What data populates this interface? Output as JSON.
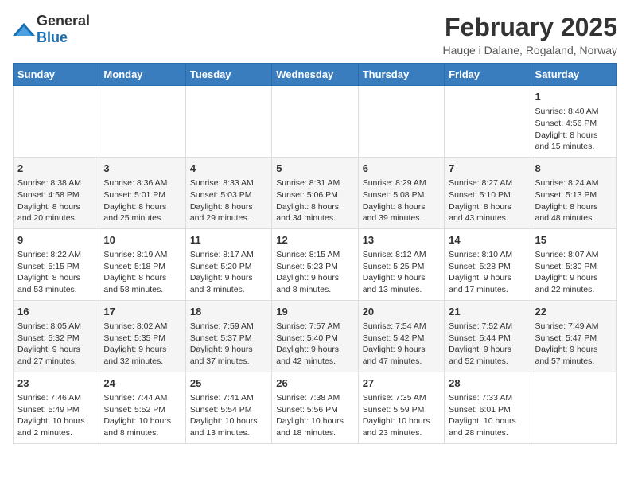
{
  "logo": {
    "general": "General",
    "blue": "Blue"
  },
  "title": "February 2025",
  "subtitle": "Hauge i Dalane, Rogaland, Norway",
  "days_of_week": [
    "Sunday",
    "Monday",
    "Tuesday",
    "Wednesday",
    "Thursday",
    "Friday",
    "Saturday"
  ],
  "weeks": [
    [
      {
        "day": "",
        "content": ""
      },
      {
        "day": "",
        "content": ""
      },
      {
        "day": "",
        "content": ""
      },
      {
        "day": "",
        "content": ""
      },
      {
        "day": "",
        "content": ""
      },
      {
        "day": "",
        "content": ""
      },
      {
        "day": "1",
        "content": "Sunrise: 8:40 AM\nSunset: 4:56 PM\nDaylight: 8 hours and 15 minutes."
      }
    ],
    [
      {
        "day": "2",
        "content": "Sunrise: 8:38 AM\nSunset: 4:58 PM\nDaylight: 8 hours and 20 minutes."
      },
      {
        "day": "3",
        "content": "Sunrise: 8:36 AM\nSunset: 5:01 PM\nDaylight: 8 hours and 25 minutes."
      },
      {
        "day": "4",
        "content": "Sunrise: 8:33 AM\nSunset: 5:03 PM\nDaylight: 8 hours and 29 minutes."
      },
      {
        "day": "5",
        "content": "Sunrise: 8:31 AM\nSunset: 5:06 PM\nDaylight: 8 hours and 34 minutes."
      },
      {
        "day": "6",
        "content": "Sunrise: 8:29 AM\nSunset: 5:08 PM\nDaylight: 8 hours and 39 minutes."
      },
      {
        "day": "7",
        "content": "Sunrise: 8:27 AM\nSunset: 5:10 PM\nDaylight: 8 hours and 43 minutes."
      },
      {
        "day": "8",
        "content": "Sunrise: 8:24 AM\nSunset: 5:13 PM\nDaylight: 8 hours and 48 minutes."
      }
    ],
    [
      {
        "day": "9",
        "content": "Sunrise: 8:22 AM\nSunset: 5:15 PM\nDaylight: 8 hours and 53 minutes."
      },
      {
        "day": "10",
        "content": "Sunrise: 8:19 AM\nSunset: 5:18 PM\nDaylight: 8 hours and 58 minutes."
      },
      {
        "day": "11",
        "content": "Sunrise: 8:17 AM\nSunset: 5:20 PM\nDaylight: 9 hours and 3 minutes."
      },
      {
        "day": "12",
        "content": "Sunrise: 8:15 AM\nSunset: 5:23 PM\nDaylight: 9 hours and 8 minutes."
      },
      {
        "day": "13",
        "content": "Sunrise: 8:12 AM\nSunset: 5:25 PM\nDaylight: 9 hours and 13 minutes."
      },
      {
        "day": "14",
        "content": "Sunrise: 8:10 AM\nSunset: 5:28 PM\nDaylight: 9 hours and 17 minutes."
      },
      {
        "day": "15",
        "content": "Sunrise: 8:07 AM\nSunset: 5:30 PM\nDaylight: 9 hours and 22 minutes."
      }
    ],
    [
      {
        "day": "16",
        "content": "Sunrise: 8:05 AM\nSunset: 5:32 PM\nDaylight: 9 hours and 27 minutes."
      },
      {
        "day": "17",
        "content": "Sunrise: 8:02 AM\nSunset: 5:35 PM\nDaylight: 9 hours and 32 minutes."
      },
      {
        "day": "18",
        "content": "Sunrise: 7:59 AM\nSunset: 5:37 PM\nDaylight: 9 hours and 37 minutes."
      },
      {
        "day": "19",
        "content": "Sunrise: 7:57 AM\nSunset: 5:40 PM\nDaylight: 9 hours and 42 minutes."
      },
      {
        "day": "20",
        "content": "Sunrise: 7:54 AM\nSunset: 5:42 PM\nDaylight: 9 hours and 47 minutes."
      },
      {
        "day": "21",
        "content": "Sunrise: 7:52 AM\nSunset: 5:44 PM\nDaylight: 9 hours and 52 minutes."
      },
      {
        "day": "22",
        "content": "Sunrise: 7:49 AM\nSunset: 5:47 PM\nDaylight: 9 hours and 57 minutes."
      }
    ],
    [
      {
        "day": "23",
        "content": "Sunrise: 7:46 AM\nSunset: 5:49 PM\nDaylight: 10 hours and 2 minutes."
      },
      {
        "day": "24",
        "content": "Sunrise: 7:44 AM\nSunset: 5:52 PM\nDaylight: 10 hours and 8 minutes."
      },
      {
        "day": "25",
        "content": "Sunrise: 7:41 AM\nSunset: 5:54 PM\nDaylight: 10 hours and 13 minutes."
      },
      {
        "day": "26",
        "content": "Sunrise: 7:38 AM\nSunset: 5:56 PM\nDaylight: 10 hours and 18 minutes."
      },
      {
        "day": "27",
        "content": "Sunrise: 7:35 AM\nSunset: 5:59 PM\nDaylight: 10 hours and 23 minutes."
      },
      {
        "day": "28",
        "content": "Sunrise: 7:33 AM\nSunset: 6:01 PM\nDaylight: 10 hours and 28 minutes."
      },
      {
        "day": "",
        "content": ""
      }
    ]
  ]
}
